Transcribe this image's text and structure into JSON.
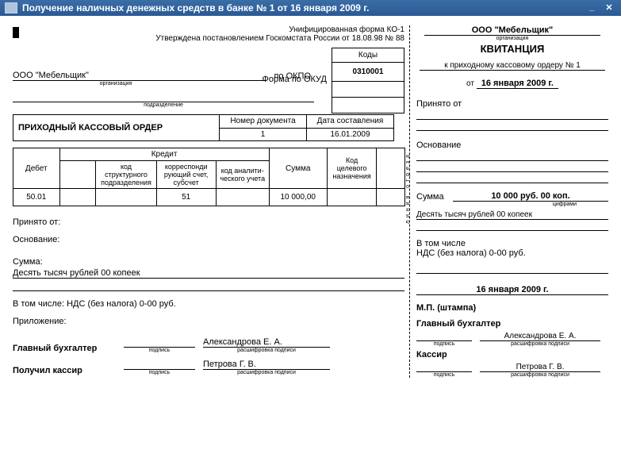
{
  "window": {
    "title": "Получение наличных денежных средств в банке № 1 от 16 января 2009 г."
  },
  "header": {
    "form_unified": "Унифицированная форма КО-1",
    "approved": "Утверждена постановлением Госкомстата России от 18.08.98 № 88"
  },
  "codes": {
    "label_kody": "Коды",
    "label_okud": "Форма по ОКУД",
    "okud": "0310001",
    "label_okpo": "по ОКПО",
    "okpo": ""
  },
  "org": {
    "name": "ООО \"Мебельщик\"",
    "sub_org": "организация",
    "sub_dep": "подразделение"
  },
  "doc_title": "ПРИХОДНЫЙ КАССОВЫЙ ОРДЕР",
  "docnum": {
    "hdr_num": "Номер документа",
    "hdr_date": "Дата составления",
    "num": "1",
    "date": "16.01.2009"
  },
  "table": {
    "hdr_debet": "Дебет",
    "hdr_kredit": "Кредит",
    "hdr_kod_struct": "код структурного подразделения",
    "hdr_korr": "корреспонди рующий счет, субсчет",
    "hdr_analit": "код аналити-ческого учета",
    "hdr_summa": "Сумма",
    "hdr_kod_cel": "Код целевого назначения",
    "debet": "50.01",
    "kod_struct": "",
    "korr": "51",
    "analit": "",
    "summa": "10 000,00",
    "kod_cel": "",
    "extra": ""
  },
  "lines": {
    "prinyato": "Принято от:",
    "osnovanie": "Основание:",
    "summa_lbl": "Сумма:",
    "summa_words": "Десять тысяч рублей 00 копеек",
    "vtom_nds": "В том числе: НДС (без налога) 0-00 руб.",
    "pril": "Приложение:"
  },
  "sig": {
    "glavbuh": "Главный бухгалтер",
    "poluchil": "Получил кассир",
    "podpis": "подпись",
    "rasshifr": "расшифровка подписи",
    "glavbuh_name": "Александрова Е. А.",
    "kassir_name": "Петрова Г. В."
  },
  "receipt": {
    "org": "ООО \"Мебельщик\"",
    "sub_org": "организация",
    "title": "КВИТАНЦИЯ",
    "to_order": "к приходному кассовому ордеру № 1",
    "ot": "от",
    "date": "16 января 2009 г.",
    "prinyato": "Принято от",
    "osnovanie": "Основание",
    "summa_lbl": "Сумма",
    "summa_val": "10 000 руб. 00 коп.",
    "cifr": "цифрами",
    "summa_words": "Десять тысяч рублей 00 копеек",
    "vtom": "В том числе",
    "nds": "НДС (без налога) 0-00 руб.",
    "date2": "16 января 2009 г.",
    "mp": "М.П. (штампа)",
    "glavbuh": "Главный бухгалтер",
    "glavbuh_name": "Александрова Е. А.",
    "kassir": "Кассир",
    "kassir_name": "Петрова Г. В.",
    "podpis": "подпись",
    "rasshifr": "расшифровка подписи"
  }
}
